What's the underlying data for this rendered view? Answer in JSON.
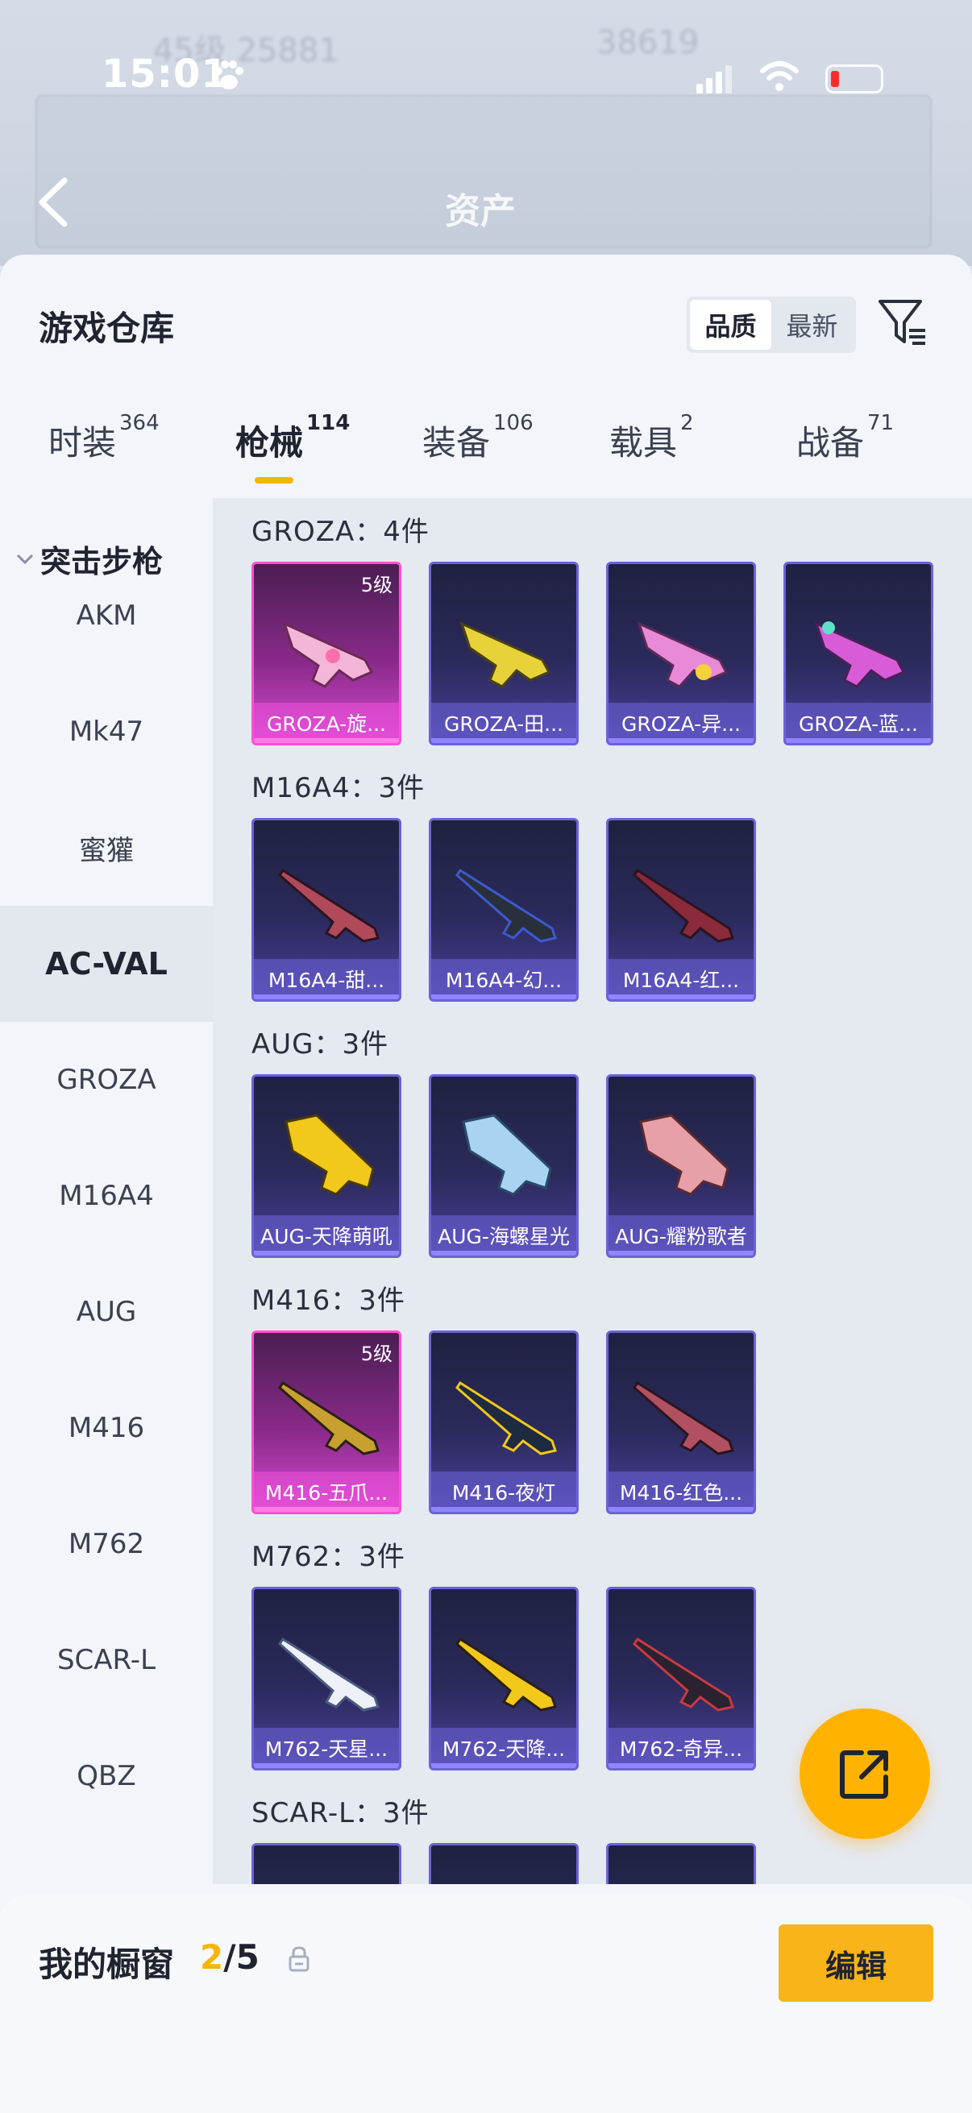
{
  "status_bar": {
    "time": "15:01"
  },
  "header": {
    "title": "资产"
  },
  "warehouse": {
    "title": "游戏仓库",
    "sort_options": [
      "品质",
      "最新"
    ]
  },
  "tabs": [
    {
      "label": "时装",
      "count": "364"
    },
    {
      "label": "枪械",
      "count": "114"
    },
    {
      "label": "装备",
      "count": "106"
    },
    {
      "label": "载具",
      "count": "2"
    },
    {
      "label": "战备",
      "count": "71"
    }
  ],
  "category_group": "突击步枪",
  "categories": [
    "AKM",
    "Mk47",
    "蜜獾",
    "AC-VAL",
    "GROZA",
    "M16A4",
    "AUG",
    "M416",
    "M762",
    "SCAR-L",
    "QBZ"
  ],
  "groups": [
    {
      "label": "GROZA：4件",
      "items": [
        {
          "name": "GROZA-旋...",
          "level": "5级"
        },
        {
          "name": "GROZA-田..."
        },
        {
          "name": "GROZA-异..."
        },
        {
          "name": "GROZA-蓝..."
        }
      ]
    },
    {
      "label": "M16A4：3件",
      "items": [
        {
          "name": "M16A4-甜..."
        },
        {
          "name": "M16A4-幻..."
        },
        {
          "name": "M16A4-红..."
        }
      ]
    },
    {
      "label": "AUG：3件",
      "items": [
        {
          "name": "AUG-天降萌吼"
        },
        {
          "name": "AUG-海螺星光"
        },
        {
          "name": "AUG-耀粉歌者"
        }
      ]
    },
    {
      "label": "M416：3件",
      "items": [
        {
          "name": "M416-五爪...",
          "level": "5级"
        },
        {
          "name": "M416-夜灯"
        },
        {
          "name": "M416-红色..."
        }
      ]
    },
    {
      "label": "M762：3件",
      "items": [
        {
          "name": "M762-天星..."
        },
        {
          "name": "M762-天降..."
        },
        {
          "name": "M762-奇异..."
        }
      ]
    },
    {
      "label": "SCAR-L：3件",
      "items": [
        {
          "name": ""
        },
        {
          "name": ""
        },
        {
          "name": ""
        }
      ]
    }
  ],
  "showcase": {
    "label": "我的橱窗",
    "current": "2",
    "total": "/5",
    "edit_label": "编辑"
  },
  "colors": {
    "accent": "#f8b418",
    "card_border": "#6b62d8",
    "card_gold": "#ff4fd0"
  }
}
